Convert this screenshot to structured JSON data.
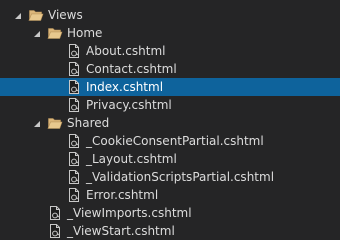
{
  "tree": {
    "items": [
      {
        "label": "Views",
        "type": "folder",
        "expanded": true,
        "depth": 0,
        "selected": false
      },
      {
        "label": "Home",
        "type": "folder",
        "expanded": true,
        "depth": 1,
        "selected": false
      },
      {
        "label": "About.cshtml",
        "type": "file",
        "depth": 2,
        "selected": false
      },
      {
        "label": "Contact.cshtml",
        "type": "file",
        "depth": 2,
        "selected": false
      },
      {
        "label": "Index.cshtml",
        "type": "file",
        "depth": 2,
        "selected": true
      },
      {
        "label": "Privacy.cshtml",
        "type": "file",
        "depth": 2,
        "selected": false
      },
      {
        "label": "Shared",
        "type": "folder",
        "expanded": true,
        "depth": 1,
        "selected": false
      },
      {
        "label": "_CookieConsentPartial.cshtml",
        "type": "file",
        "depth": 2,
        "selected": false
      },
      {
        "label": "_Layout.cshtml",
        "type": "file",
        "depth": 2,
        "selected": false
      },
      {
        "label": "_ValidationScriptsPartial.cshtml",
        "type": "file",
        "depth": 2,
        "selected": false
      },
      {
        "label": "Error.cshtml",
        "type": "file",
        "depth": 2,
        "selected": false
      },
      {
        "label": "_ViewImports.cshtml",
        "type": "file",
        "depth": 1,
        "selected": false
      },
      {
        "label": "_ViewStart.cshtml",
        "type": "file",
        "depth": 1,
        "selected": false
      }
    ]
  },
  "colors": {
    "background": "#252526",
    "text": "#dcdcdc",
    "selection": "#0e639c",
    "folder": "#dcb67a",
    "arrow": "#c8c8c8"
  },
  "icons": {
    "folder": "folder-open-icon",
    "file": "razor-file-icon",
    "expander": "expanded-arrow-icon"
  }
}
